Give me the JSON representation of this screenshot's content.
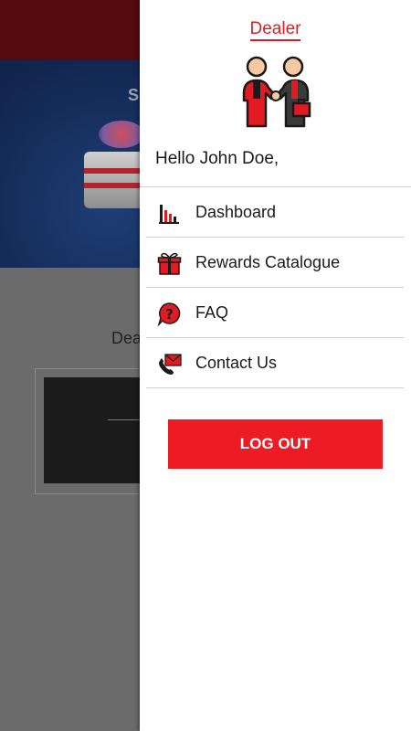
{
  "drawer": {
    "title": "Dealer",
    "greeting": "Hello John Doe,",
    "menu": [
      {
        "label": "Dashboard",
        "icon": "bar-chart-icon"
      },
      {
        "label": "Rewards Catalogue",
        "icon": "gift-icon"
      },
      {
        "label": "FAQ",
        "icon": "question-icon"
      },
      {
        "label": "Contact Us",
        "icon": "phone-mail-icon"
      }
    ],
    "logout_label": "LOG OUT"
  },
  "background": {
    "banner_letter": "S",
    "label": "Dea"
  },
  "colors": {
    "accent": "#ed1c24",
    "topbar": "#550a0e",
    "overlay": "#6b6b6b"
  }
}
